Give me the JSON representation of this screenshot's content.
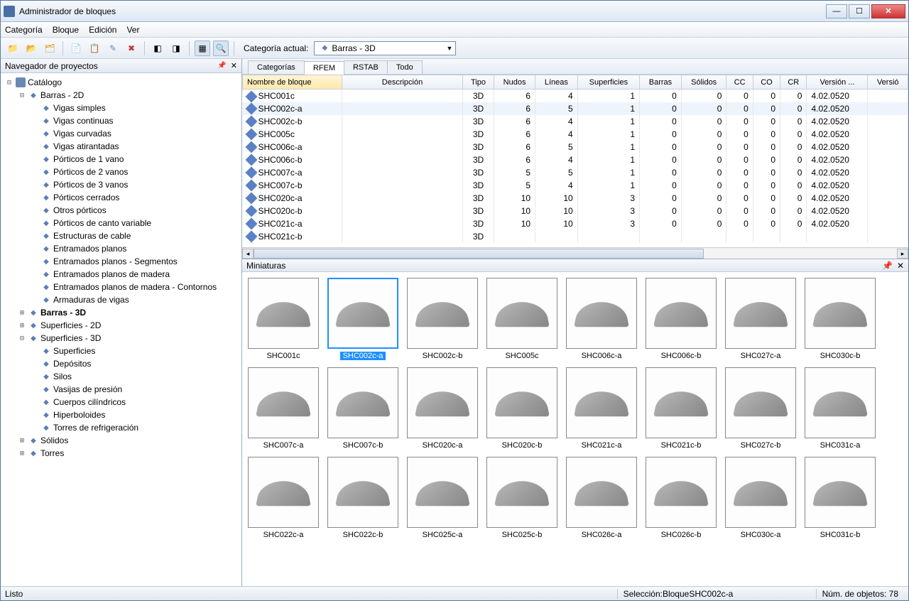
{
  "window": {
    "title": "Administrador de bloques"
  },
  "menu": [
    "Categoría",
    "Bloque",
    "Edición",
    "Ver"
  ],
  "toolbar": {
    "category_label": "Categoría actual:",
    "category_value": "Barras - 3D"
  },
  "projectNav": {
    "title": "Navegador de proyectos",
    "root": "Catálogo",
    "groups": [
      {
        "label": "Barras - 2D",
        "expanded": true,
        "bold": false,
        "children": [
          "Vigas simples",
          "Vigas continuas",
          "Vigas curvadas",
          "Vigas atirantadas",
          "Pórticos de 1 vano",
          "Pórticos de 2 vanos",
          "Pórticos de 3 vanos",
          "Pórticos cerrados",
          "Otros pórticos",
          "Pórticos de canto variable",
          "Estructuras de cable",
          "Entramados planos",
          "Entramados planos - Segmentos",
          "Entramados planos de madera",
          "Entramados planos de madera - Contornos",
          "Armaduras de vigas"
        ]
      },
      {
        "label": "Barras - 3D",
        "expanded": false,
        "bold": true,
        "children": []
      },
      {
        "label": "Superficies - 2D",
        "expanded": false,
        "bold": false,
        "children": []
      },
      {
        "label": "Superficies - 3D",
        "expanded": true,
        "bold": false,
        "children": [
          "Superficies",
          "Depósitos",
          "Silos",
          "Vasijas de presión",
          "Cuerpos cilíndricos",
          "Hiperboloides",
          "Torres de refrigeración"
        ]
      },
      {
        "label": "Sólidos",
        "expanded": false,
        "bold": false,
        "children": []
      },
      {
        "label": "Torres",
        "expanded": false,
        "bold": false,
        "children": []
      }
    ]
  },
  "tabs": [
    "Categorías",
    "RFEM",
    "RSTAB",
    "Todo"
  ],
  "activeTab": 1,
  "grid": {
    "columns": [
      "Nombre de bloque",
      "Descripción",
      "Tipo",
      "Nudos",
      "Líneas",
      "Superficies",
      "Barras",
      "Sólidos",
      "CC",
      "CO",
      "CR",
      "Versión ...",
      "Versió"
    ],
    "rows": [
      {
        "name": "SHC001c",
        "desc": "",
        "tipo": "3D",
        "nudos": 6,
        "lineas": 4,
        "sup": 1,
        "barras": 0,
        "solidos": 0,
        "cc": 0,
        "co": 0,
        "cr": 0,
        "ver": "4.02.0520"
      },
      {
        "name": "SHC002c-a",
        "desc": "",
        "tipo": "3D",
        "nudos": 6,
        "lineas": 5,
        "sup": 1,
        "barras": 0,
        "solidos": 0,
        "cc": 0,
        "co": 0,
        "cr": 0,
        "ver": "4.02.0520",
        "sel": true
      },
      {
        "name": "SHC002c-b",
        "desc": "",
        "tipo": "3D",
        "nudos": 6,
        "lineas": 4,
        "sup": 1,
        "barras": 0,
        "solidos": 0,
        "cc": 0,
        "co": 0,
        "cr": 0,
        "ver": "4.02.0520"
      },
      {
        "name": "SHC005c",
        "desc": "",
        "tipo": "3D",
        "nudos": 6,
        "lineas": 4,
        "sup": 1,
        "barras": 0,
        "solidos": 0,
        "cc": 0,
        "co": 0,
        "cr": 0,
        "ver": "4.02.0520"
      },
      {
        "name": "SHC006c-a",
        "desc": "",
        "tipo": "3D",
        "nudos": 6,
        "lineas": 5,
        "sup": 1,
        "barras": 0,
        "solidos": 0,
        "cc": 0,
        "co": 0,
        "cr": 0,
        "ver": "4.02.0520"
      },
      {
        "name": "SHC006c-b",
        "desc": "",
        "tipo": "3D",
        "nudos": 6,
        "lineas": 4,
        "sup": 1,
        "barras": 0,
        "solidos": 0,
        "cc": 0,
        "co": 0,
        "cr": 0,
        "ver": "4.02.0520"
      },
      {
        "name": "SHC007c-a",
        "desc": "",
        "tipo": "3D",
        "nudos": 5,
        "lineas": 5,
        "sup": 1,
        "barras": 0,
        "solidos": 0,
        "cc": 0,
        "co": 0,
        "cr": 0,
        "ver": "4.02.0520"
      },
      {
        "name": "SHC007c-b",
        "desc": "",
        "tipo": "3D",
        "nudos": 5,
        "lineas": 4,
        "sup": 1,
        "barras": 0,
        "solidos": 0,
        "cc": 0,
        "co": 0,
        "cr": 0,
        "ver": "4.02.0520"
      },
      {
        "name": "SHC020c-a",
        "desc": "",
        "tipo": "3D",
        "nudos": 10,
        "lineas": 10,
        "sup": 3,
        "barras": 0,
        "solidos": 0,
        "cc": 0,
        "co": 0,
        "cr": 0,
        "ver": "4.02.0520"
      },
      {
        "name": "SHC020c-b",
        "desc": "",
        "tipo": "3D",
        "nudos": 10,
        "lineas": 10,
        "sup": 3,
        "barras": 0,
        "solidos": 0,
        "cc": 0,
        "co": 0,
        "cr": 0,
        "ver": "4.02.0520"
      },
      {
        "name": "SHC021c-a",
        "desc": "",
        "tipo": "3D",
        "nudos": 10,
        "lineas": 10,
        "sup": 3,
        "barras": 0,
        "solidos": 0,
        "cc": 0,
        "co": 0,
        "cr": 0,
        "ver": "4.02.0520"
      },
      {
        "name": "SHC021c-b",
        "desc": "",
        "tipo": "3D",
        "nudos": "",
        "lineas": "",
        "sup": "",
        "barras": "",
        "solidos": "",
        "cc": "",
        "co": "",
        "cr": "",
        "ver": ""
      }
    ]
  },
  "miniaturas": {
    "title": "Miniaturas",
    "rows": [
      [
        {
          "l": "SHC001c"
        },
        {
          "l": "SHC002c-a",
          "sel": true
        },
        {
          "l": "SHC002c-b"
        },
        {
          "l": "SHC005c"
        },
        {
          "l": "SHC006c-a"
        },
        {
          "l": "SHC006c-b"
        },
        {
          "l": "SHC027c-a"
        },
        {
          "l": "SHC030c-b"
        }
      ],
      [
        {
          "l": "SHC007c-a"
        },
        {
          "l": "SHC007c-b"
        },
        {
          "l": "SHC020c-a"
        },
        {
          "l": "SHC020c-b"
        },
        {
          "l": "SHC021c-a"
        },
        {
          "l": "SHC021c-b"
        },
        {
          "l": "SHC027c-b"
        },
        {
          "l": "SHC031c-a"
        }
      ],
      [
        {
          "l": "SHC022c-a"
        },
        {
          "l": "SHC022c-b"
        },
        {
          "l": "SHC025c-a"
        },
        {
          "l": "SHC025c-b"
        },
        {
          "l": "SHC026c-a"
        },
        {
          "l": "SHC026c-b"
        },
        {
          "l": "SHC030c-a"
        },
        {
          "l": "SHC031c-b"
        }
      ]
    ]
  },
  "status": {
    "ready": "Listo",
    "selection": "Selección:BloqueSHC002c-a",
    "count": "Núm. de objetos: 78"
  }
}
